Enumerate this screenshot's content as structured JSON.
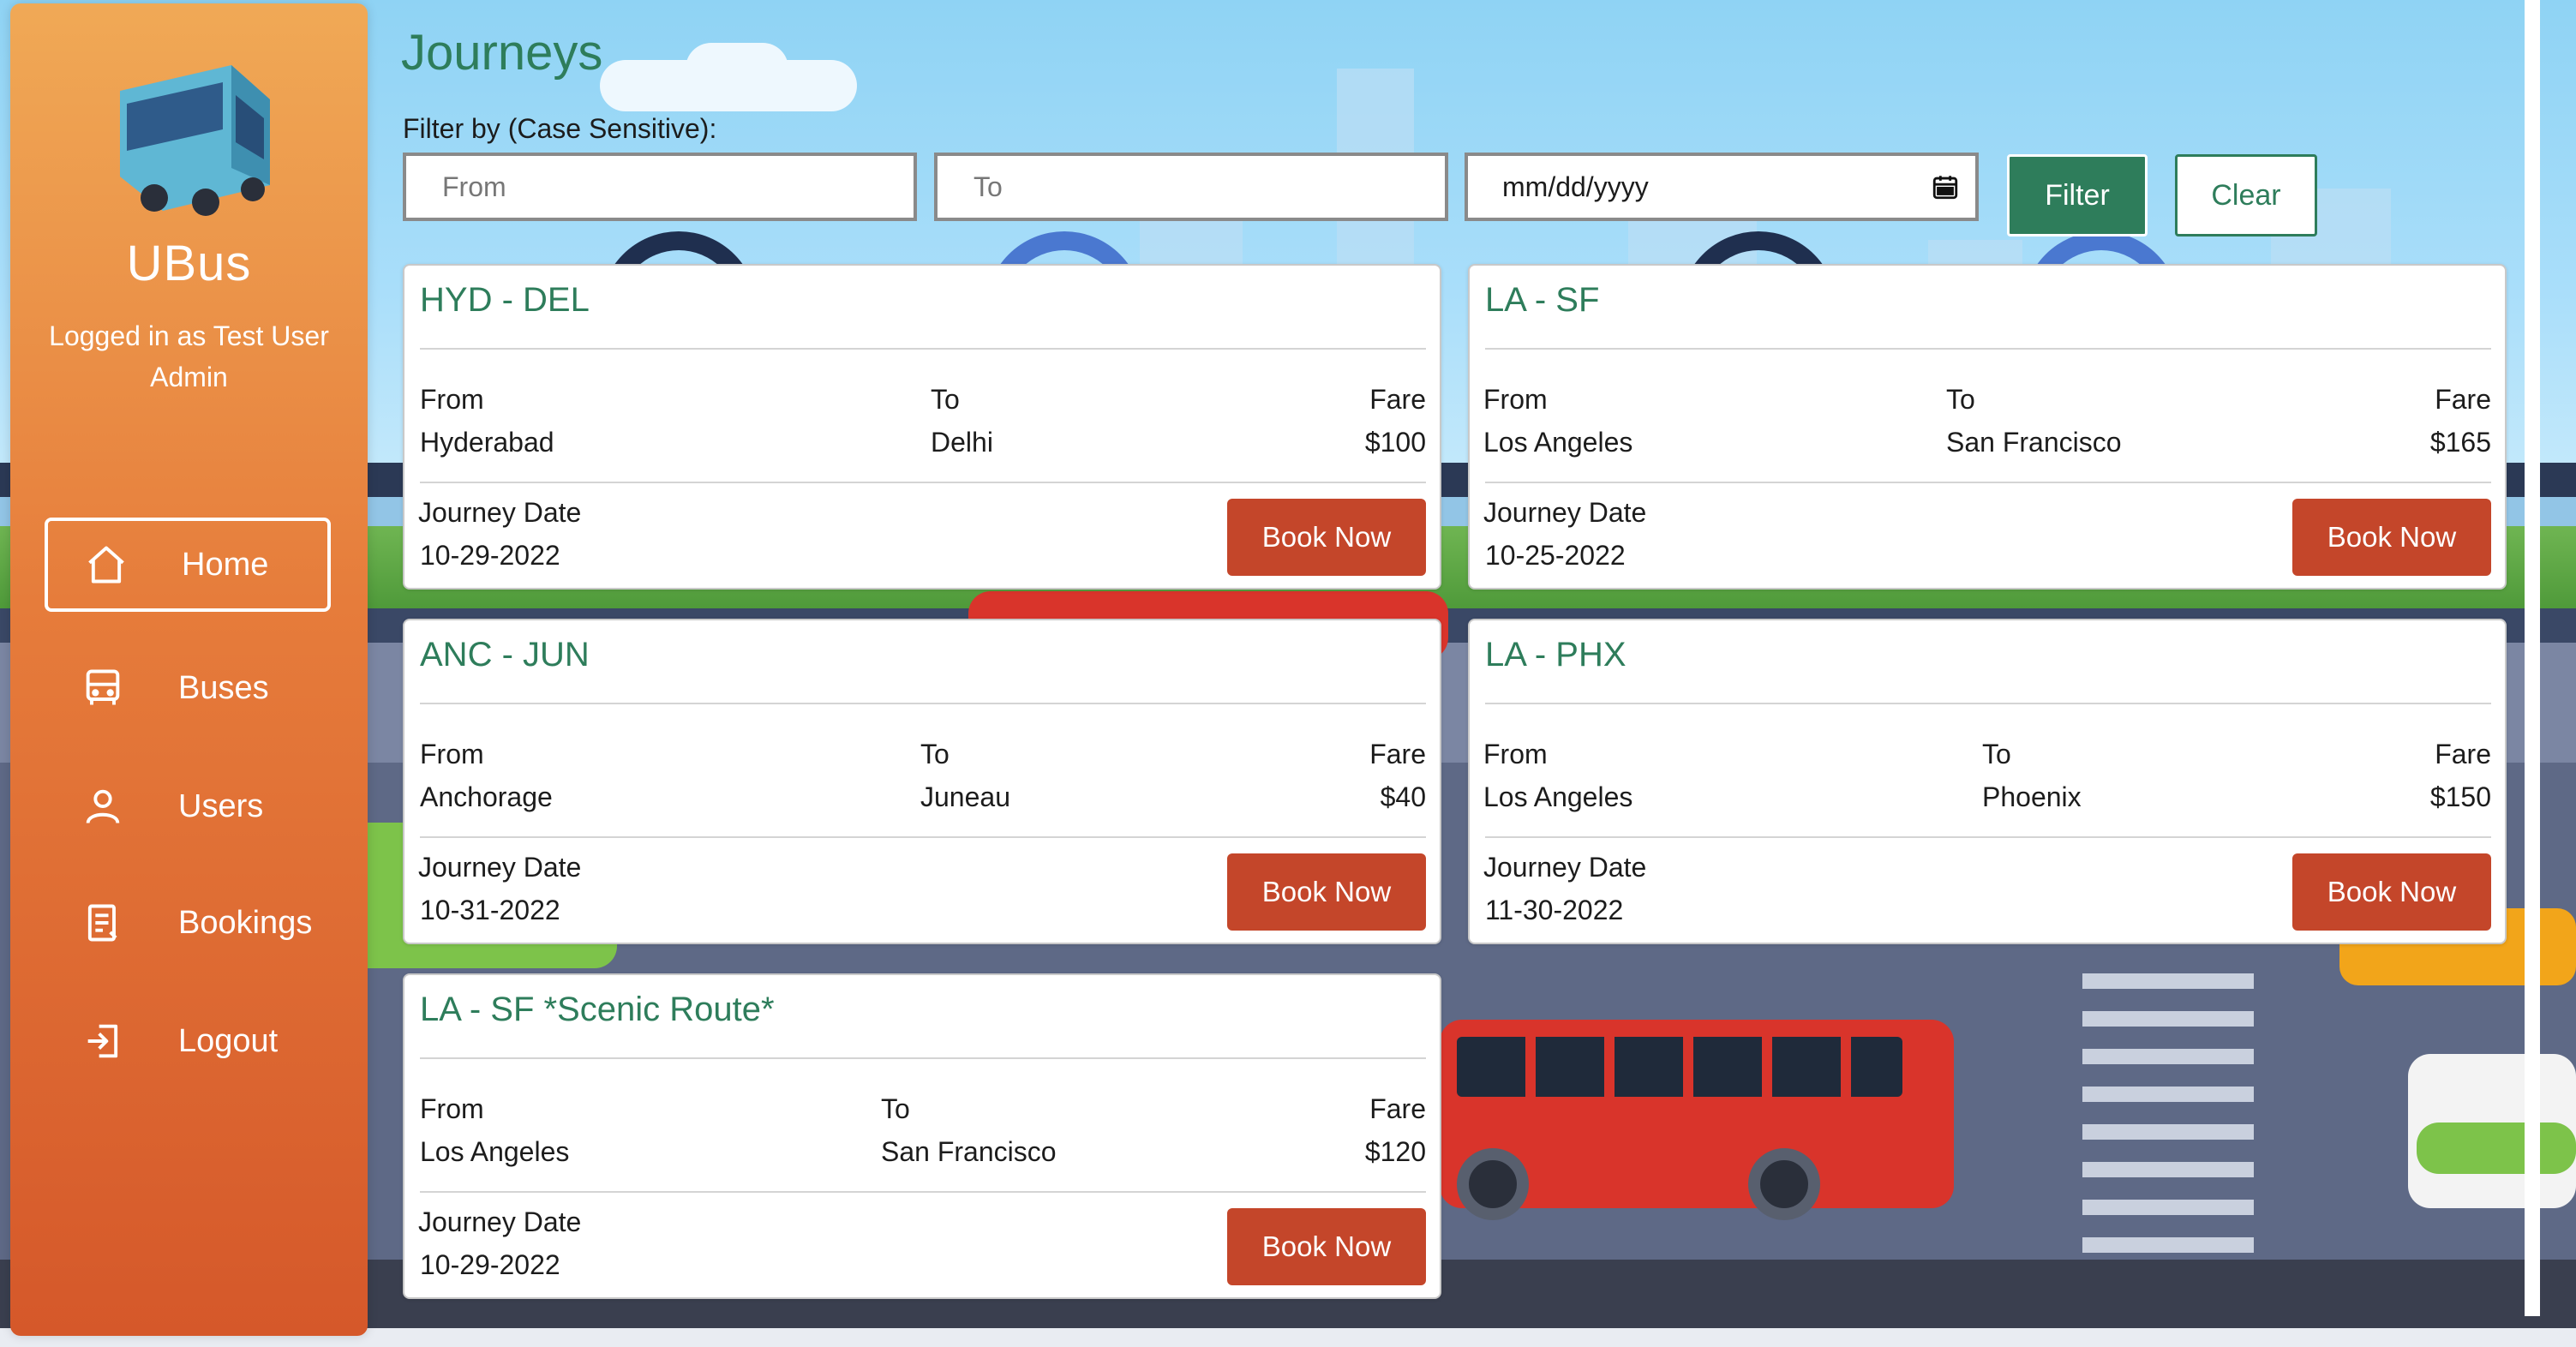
{
  "app": {
    "name": "UBus",
    "logged_in_text": "Logged in as Test User Admin"
  },
  "sidebar": {
    "items": [
      {
        "label": "Home",
        "icon": "home-icon",
        "active": true
      },
      {
        "label": "Buses",
        "icon": "bus-icon",
        "active": false
      },
      {
        "label": "Users",
        "icon": "user-icon",
        "active": false
      },
      {
        "label": "Bookings",
        "icon": "document-icon",
        "active": false
      },
      {
        "label": "Logout",
        "icon": "logout-icon",
        "active": false
      }
    ]
  },
  "main": {
    "title": "Journeys",
    "filter_label": "Filter by (Case Sensitive):",
    "from_placeholder": "From",
    "to_placeholder": "To",
    "date_placeholder": "mm/dd/yyyy",
    "filter_button": "Filter",
    "clear_button": "Clear"
  },
  "card_labels": {
    "from": "From",
    "to": "To",
    "fare": "Fare",
    "journey_date": "Journey Date",
    "book": "Book Now"
  },
  "journeys": [
    {
      "route": "HYD - DEL",
      "from": "Hyderabad",
      "to": "Delhi",
      "fare": "$100",
      "date": "10-29-2022"
    },
    {
      "route": "LA - SF",
      "from": "Los Angeles",
      "to": "San Francisco",
      "fare": "$165",
      "date": "10-25-2022"
    },
    {
      "route": "ANC - JUN",
      "from": "Anchorage",
      "to": "Juneau",
      "fare": "$40",
      "date": "10-31-2022"
    },
    {
      "route": "LA - PHX",
      "from": "Los Angeles",
      "to": "Phoenix",
      "fare": "$150",
      "date": "11-30-2022"
    },
    {
      "route": "LA - SF *Scenic Route*",
      "from": "Los Angeles",
      "to": "San Francisco",
      "fare": "$120",
      "date": "10-29-2022"
    }
  ],
  "colors": {
    "accent_green": "#2e7d5b",
    "book_button": "#c4462a",
    "sidebar_top": "#f0a956",
    "sidebar_bottom": "#d5582a"
  }
}
